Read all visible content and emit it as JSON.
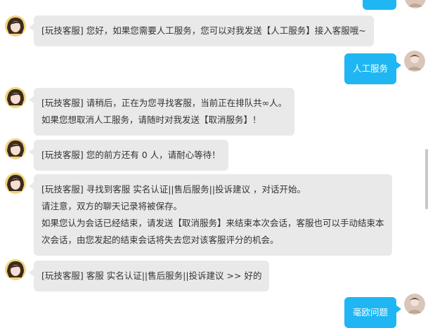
{
  "colors": {
    "agent_bubble": "#e9e9e9",
    "user_bubble": "#1fb6f3",
    "user_text": "#ffffff",
    "agent_text": "#333333"
  },
  "messages": [
    {
      "sender": "agent",
      "lines": [
        "[玩技客服] 您好，如果您需要人工服务，您可以对我发送【人工服务】接入客服哦~"
      ]
    },
    {
      "sender": "user",
      "lines": [
        "人工服务"
      ]
    },
    {
      "sender": "agent",
      "lines": [
        "[玩技客服] 请稍后，正在为您寻找客服，当前正在排队共∞人。",
        "如果您想取消人工服务，请随时对我发送【取消服务】！"
      ]
    },
    {
      "sender": "agent",
      "lines": [
        "[玩技客服] 您的前方还有 0 人，请耐心等待！"
      ]
    },
    {
      "sender": "agent",
      "lines": [
        "[玩技客服] 寻找到客服 实名认证||售后服务||投诉建议 ，对话开始。",
        "请注意，双方的聊天记录将被保存。",
        "如果您认为会话已经结束，请发送【取消服务】来结束本次会话，客服也可以手动结束本",
        "次会话，由您发起的结束会话将失去您对该客服评分的机会。"
      ]
    },
    {
      "sender": "agent",
      "lines": [
        "[玩技客服] 客服 实名认证||售后服务||投诉建议 >> 好的"
      ]
    },
    {
      "sender": "user",
      "lines": [
        "毫欧问题"
      ]
    }
  ],
  "icons": {
    "agent_avatar": "girl-avatar-icon",
    "user_avatar": "user-avatar-icon"
  }
}
